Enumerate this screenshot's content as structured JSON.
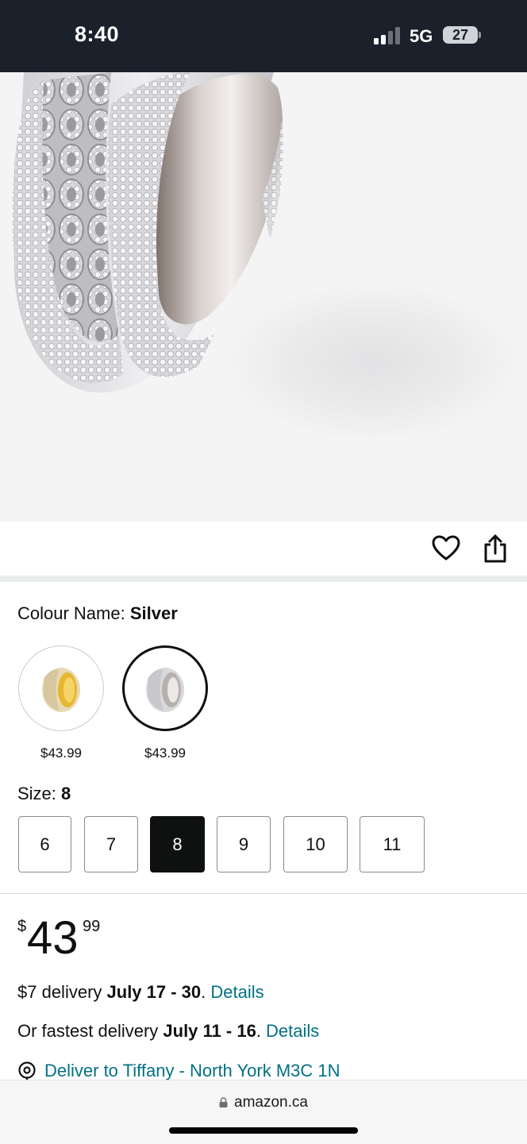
{
  "status_bar": {
    "time": "8:40",
    "network": "5G",
    "battery": "27"
  },
  "product": {
    "image_alt": "silver cuban link ring",
    "actions": {
      "wishlist_icon": "heart-icon",
      "share_icon": "share-icon"
    }
  },
  "colour": {
    "label": "Colour Name: ",
    "selected": "Silver",
    "options": [
      {
        "name": "Gold",
        "price": "$43.99",
        "selected": false
      },
      {
        "name": "Silver",
        "price": "$43.99",
        "selected": true
      }
    ]
  },
  "size": {
    "label": "Size: ",
    "selected": "8",
    "options": [
      "6",
      "7",
      "8",
      "9",
      "10",
      "11"
    ]
  },
  "price": {
    "symbol": "$",
    "whole": "43",
    "fraction": "99"
  },
  "delivery": {
    "standard_prefix": "$7 delivery ",
    "standard_dates": "July 17 - 30",
    "standard_suffix": ". ",
    "standard_link": "Details",
    "fastest_prefix": "Or fastest delivery ",
    "fastest_dates": "July 11 - 16",
    "fastest_suffix": ". ",
    "fastest_link": "Details",
    "deliver_to": "Deliver to Tiffany - North York M3C 1N"
  },
  "browser": {
    "url": "amazon.ca"
  },
  "colors": {
    "link": "#007185",
    "status_bar_bg": "#1a212b",
    "selected_size_bg": "#0f1111"
  }
}
